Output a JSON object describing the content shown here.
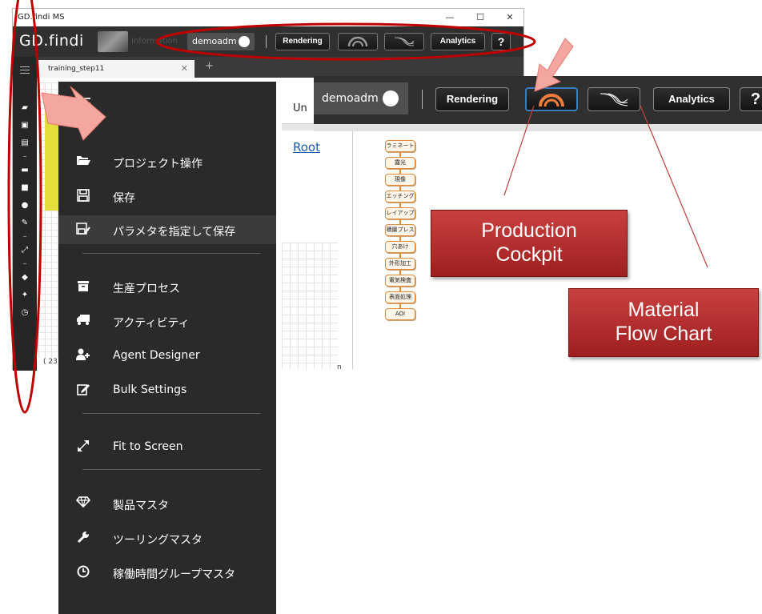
{
  "window": {
    "title": "GD.findi MS",
    "minimize": "—",
    "maximize": "☐",
    "close": "✕"
  },
  "appbar": {
    "logo": "GD.findi",
    "info_label": "Information",
    "user": "demoadm",
    "rendering_label": "Rendering",
    "analytics_label": "Analytics",
    "help_label": "?"
  },
  "tabs": {
    "active_tab": "training_step11",
    "close": "✕",
    "add": "+"
  },
  "content": {
    "un_tab": "Un",
    "root_link": "Root",
    "status_fragment": "( 23",
    "hm_fragment": "n"
  },
  "menu": {
    "items": [
      {
        "icon": "folder-open-icon",
        "label": "プロジェクト操作"
      },
      {
        "icon": "save-icon",
        "label": "保存"
      },
      {
        "icon": "save-params-icon",
        "label": "パラメタを指定して保存"
      },
      {
        "icon": "archive-icon",
        "label": "生産プロセス"
      },
      {
        "icon": "truck-icon",
        "label": "アクティビティ"
      },
      {
        "icon": "user-add-icon",
        "label": "Agent Designer"
      },
      {
        "icon": "edit-icon",
        "label": "Bulk Settings"
      },
      {
        "icon": "expand-icon",
        "label": "Fit to Screen"
      },
      {
        "icon": "diamond-icon",
        "label": "製品マスタ"
      },
      {
        "icon": "wrench-icon",
        "label": "ツーリングマスタ"
      },
      {
        "icon": "clock-icon",
        "label": "稼働時間グループマスタ"
      }
    ]
  },
  "flow_nodes": [
    "ラミネート",
    "露光",
    "現像",
    "エッチング",
    "レイアップ",
    "積層プレス",
    "穴あけ",
    "外形加工",
    "電気検査",
    "表面処理",
    "AOI"
  ],
  "zoom": {
    "user": "demoadm",
    "rendering_label": "Rendering",
    "analytics_label": "Analytics",
    "help_label": "?"
  },
  "callouts": {
    "production_line1": "Production",
    "production_line2": "Cockpit",
    "material_line1": "Material",
    "material_line2": "Flow Chart"
  },
  "colors": {
    "annotation_red": "#c00000",
    "callout_red": "#b52a2a",
    "arrow_salmon": "#f4a6a0",
    "cockpit_orange": "#f07c3c",
    "node_border": "#e08a3a"
  }
}
